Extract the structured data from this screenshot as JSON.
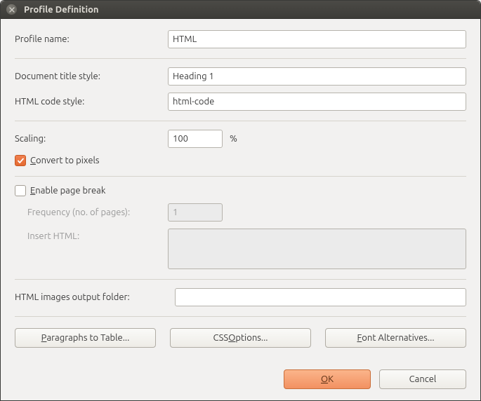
{
  "titlebar": {
    "title": "Profile Definition"
  },
  "form": {
    "profile_name": {
      "label": "Profile name:",
      "value": "HTML"
    },
    "doc_title_style": {
      "label": "Document title style:",
      "value": "Heading 1"
    },
    "html_code_style": {
      "label": "HTML code style:",
      "value": "html-code"
    },
    "scaling": {
      "label": "Scaling:",
      "value": "100",
      "unit": "%"
    },
    "convert_to_pixels": {
      "label_pre": "C",
      "label_post": "onvert to pixels",
      "checked": true
    },
    "enable_page_break": {
      "label_pre": "E",
      "label_post": "nable page break",
      "checked": false
    },
    "frequency": {
      "label": "Frequency (no. of pages):",
      "value": "1"
    },
    "insert_html": {
      "label": "Insert HTML:",
      "value": ""
    },
    "output_folder": {
      "label": "HTML images output folder:",
      "value": ""
    }
  },
  "buttons": {
    "p2t": {
      "pre": "P",
      "post": "aragraphs to Table..."
    },
    "css": {
      "pre1": "CSS ",
      "u": "O",
      "post": "ptions..."
    },
    "font": {
      "pre": "F",
      "post": "ont Alternatives..."
    },
    "ok": {
      "pre": "O",
      "post": "K"
    },
    "cancel": "Cancel"
  }
}
